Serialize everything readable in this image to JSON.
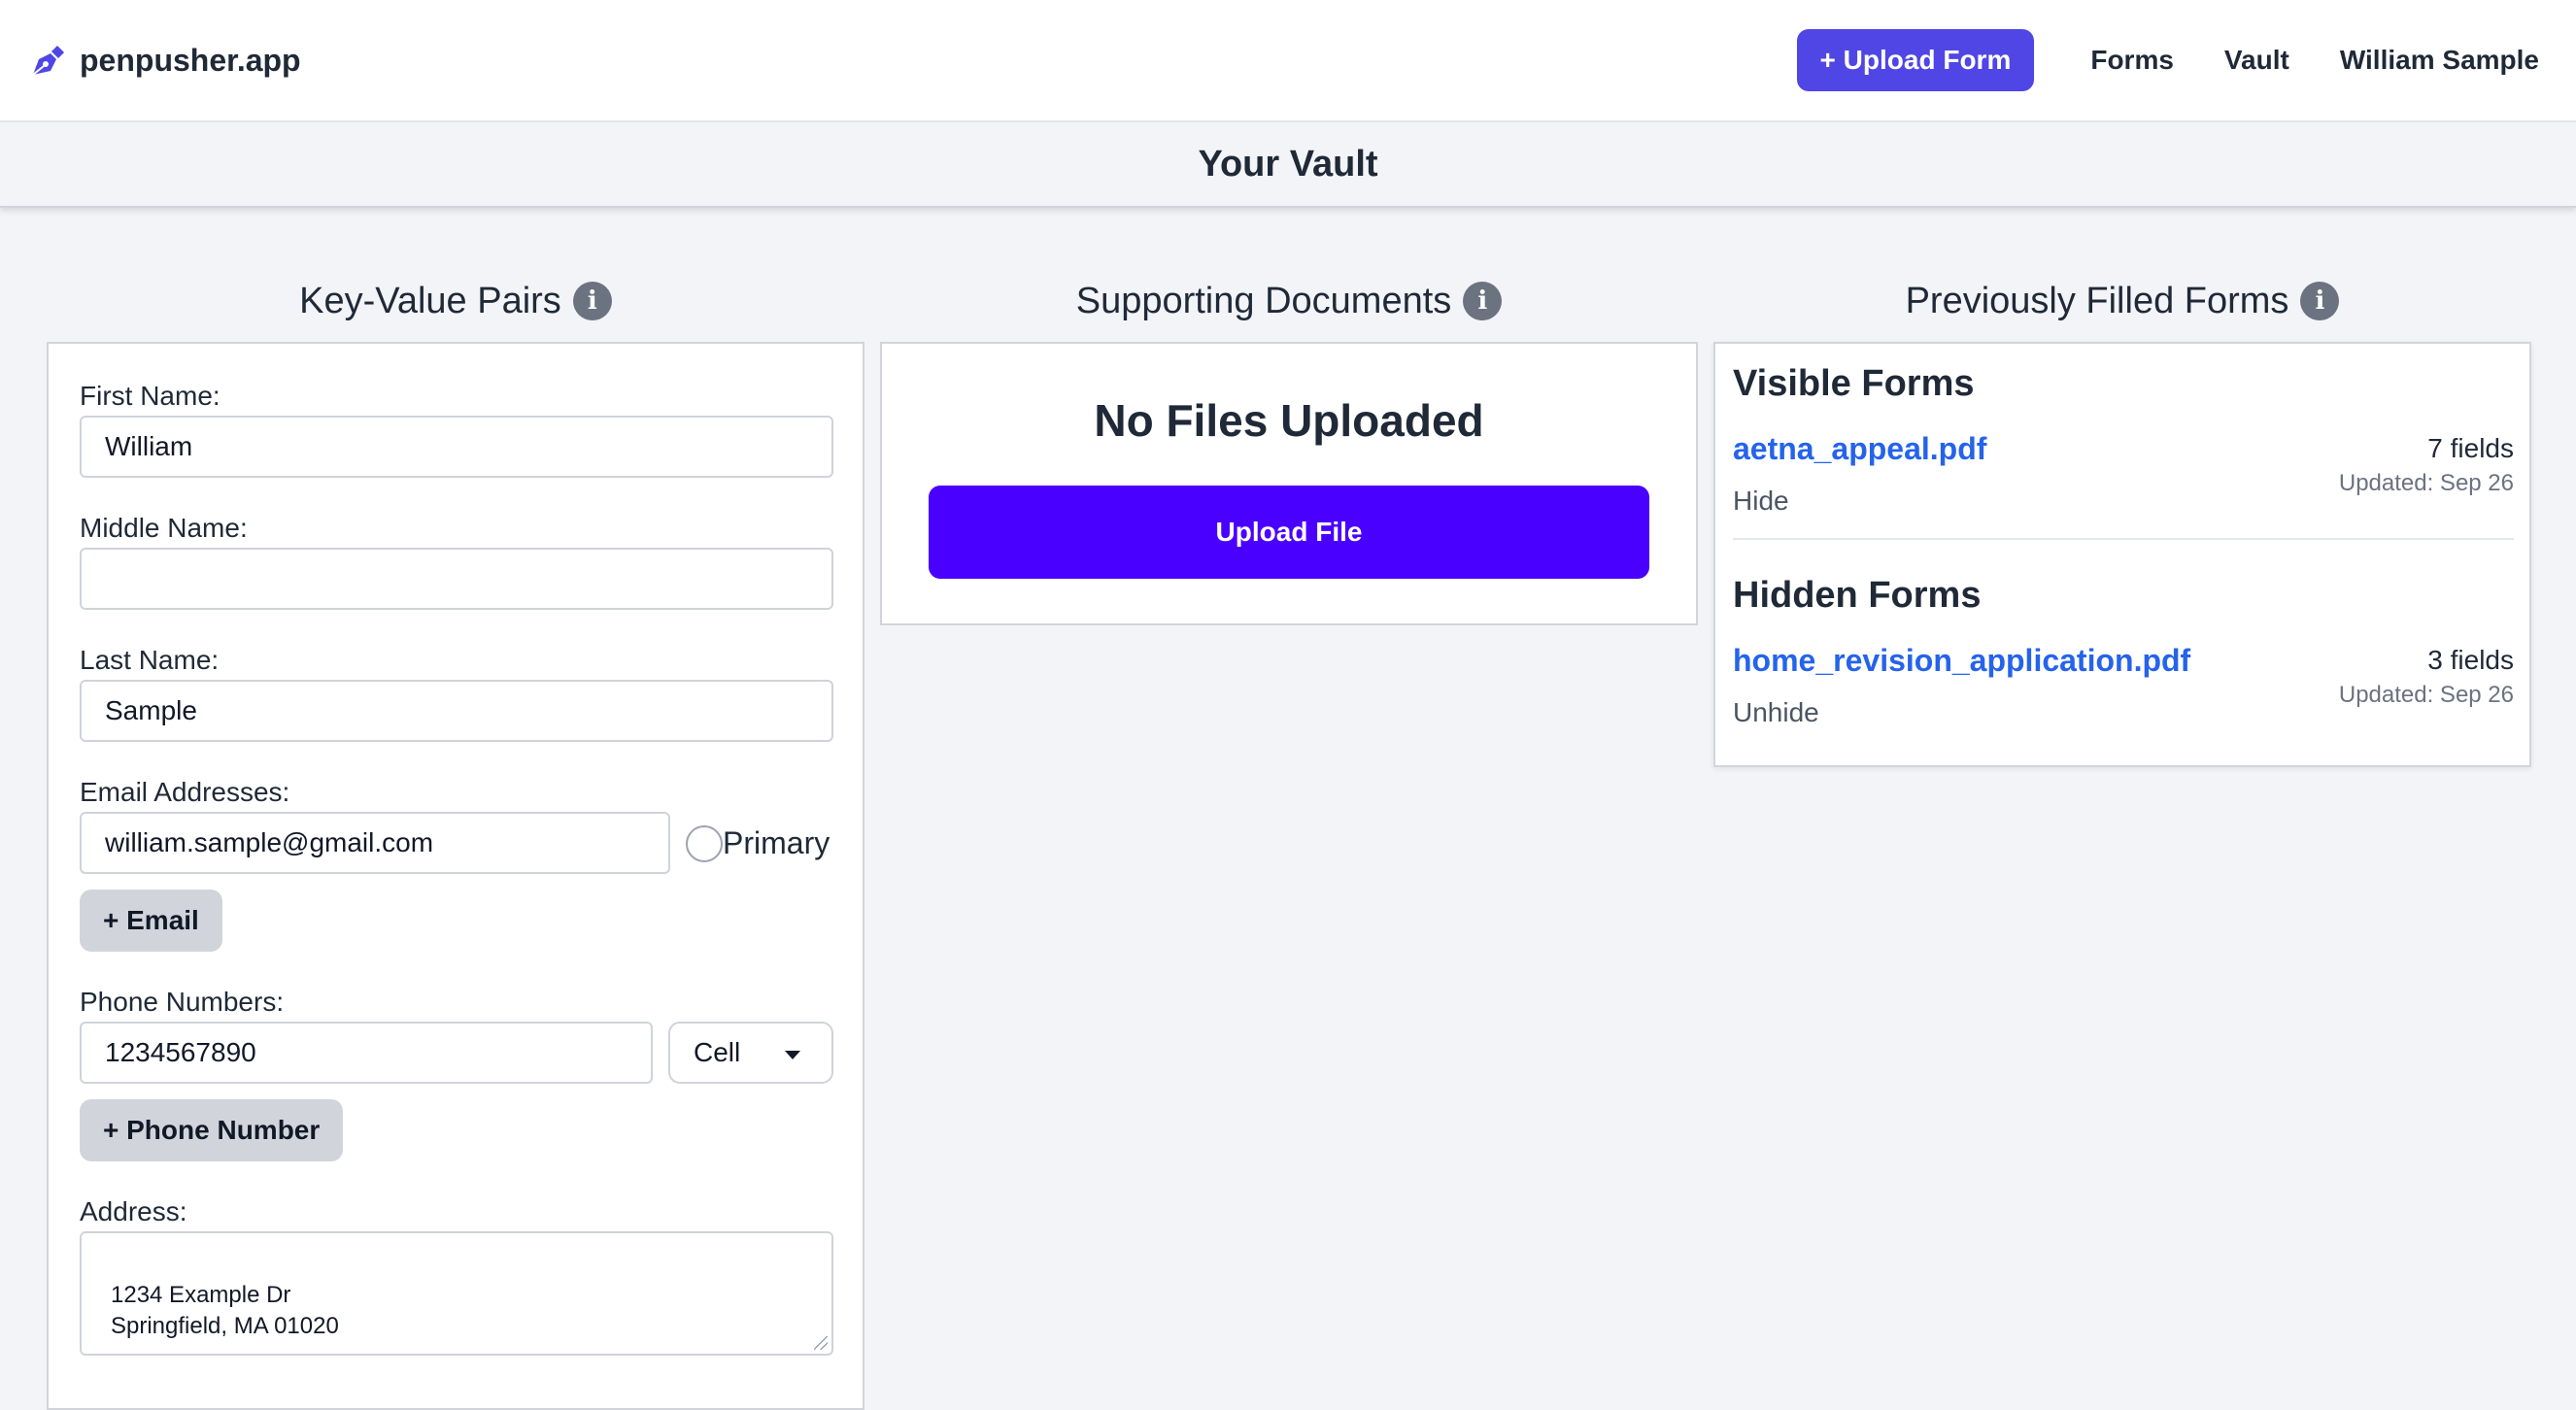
{
  "nav": {
    "brand": "penpusher.app",
    "upload_form_label": "+ Upload Form",
    "links": [
      "Forms",
      "Vault",
      "William Sample"
    ]
  },
  "page": {
    "title": "Your Vault"
  },
  "columns": {
    "kv_title": "Key-Value Pairs",
    "docs_title": "Supporting Documents",
    "forms_title": "Previously Filled Forms"
  },
  "kv": {
    "first_name_label": "First Name:",
    "first_name_value": "William",
    "middle_name_label": "Middle Name:",
    "middle_name_value": "",
    "last_name_label": "Last Name:",
    "last_name_value": "Sample",
    "email_label": "Email Addresses:",
    "email_value": "william.sample@gmail.com",
    "primary_label": "Primary",
    "add_email_label": "+ Email",
    "phone_label": "Phone Numbers:",
    "phone_value": "1234567890",
    "phone_type": "Cell",
    "add_phone_label": "+ Phone Number",
    "address_label": "Address:",
    "address_value": "1234 Example Dr\nSpringfield, MA 01020"
  },
  "docs": {
    "empty_title": "No Files Uploaded",
    "upload_label": "Upload File"
  },
  "forms": {
    "visible_heading": "Visible Forms",
    "visible": [
      {
        "name": "aetna_appeal.pdf",
        "action": "Hide",
        "fields": "7 fields",
        "updated": "Updated: Sep 26"
      }
    ],
    "hidden_heading": "Hidden Forms",
    "hidden": [
      {
        "name": "home_revision_application.pdf",
        "action": "Unhide",
        "fields": "3 fields",
        "updated": "Updated: Sep 26"
      }
    ]
  },
  "colors": {
    "accent": "#4f46e5",
    "upload_file_button": "#4a00ff",
    "link": "#2563eb"
  }
}
